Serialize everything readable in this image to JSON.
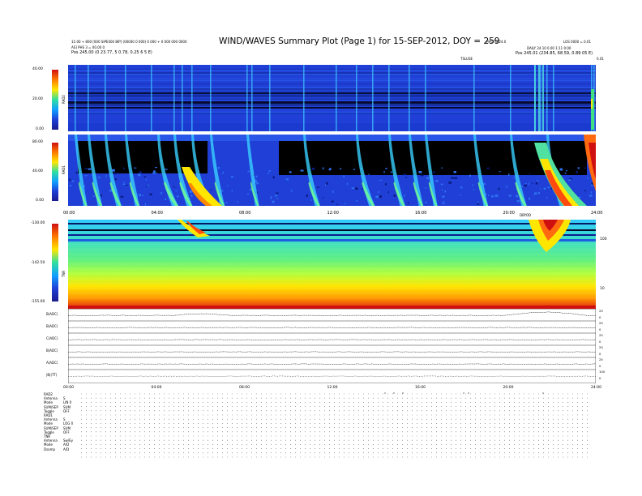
{
  "header": {
    "left_line1": "11:00 + 800 [000 SIPE000 BIP] (00000 0 000) 0 000 + 0 000 000 0000",
    "left_line2": "AS] PHS 3 = 00.00 0",
    "left_line3": "Pos 245.00 (0 23.77, 5 0.78, 0.25 6 5 E)",
    "center_right_label": "PHOTO 24.0",
    "right_line1": "LOS 0000 = 0.01",
    "right_line2": "DAILY 24.10 0.00 1:11 0:00",
    "right_line3": "Pos 245.01 (234.85, 68.59, 0.89 05 E)",
    "small_top_center": "TSLUSE",
    "small_top_right": "0.01"
  },
  "title": "WIND/WAVES Summary Plot (Page 1) for 15-SEP-2012, DOY = 259",
  "colors": {
    "spectrogram_background": "#1f3fd6",
    "dark_band": "#050a30",
    "black_region": "#000000",
    "hot": "#d01010"
  },
  "chart_data": [
    {
      "type": "heatmap",
      "panel": "RAD2",
      "ylabel": "RAD2",
      "yticks": [
        "40.00",
        "20.00",
        "0.00"
      ],
      "ylim": [
        0,
        40
      ],
      "x_ticks": [
        "00:00",
        "04:00",
        "08:00",
        "12:00",
        "16:00",
        "20:00",
        "24:00"
      ]
    },
    {
      "type": "heatmap",
      "panel": "RAD1",
      "ylabel": "RAD1",
      "yticks": [
        "80.00",
        "40.00",
        "0.00"
      ],
      "ylim": [
        0,
        80
      ],
      "x_ticks": [
        "00:00",
        "04:00",
        "08:00",
        "12:00",
        "16:00",
        "20:00",
        "24:00"
      ],
      "annotation": "DBYOD"
    },
    {
      "type": "heatmap",
      "panel": "TNR",
      "ylabel": "TNR",
      "yticks": [
        "-130.00",
        "-142.50",
        "-155.00"
      ],
      "right_ticks": [
        "100",
        "10"
      ],
      "ylim": [
        -155,
        -130
      ]
    },
    {
      "type": "line",
      "panel": "magnetic field",
      "series": [
        {
          "name": "B(ADC)",
          "right_ticks": [
            "25",
            "0"
          ]
        },
        {
          "name": "B(ADC)",
          "right_ticks": [
            "25",
            "0"
          ]
        },
        {
          "name": "C(ADC)",
          "right_ticks": [
            "25",
            "0"
          ]
        },
        {
          "name": "B(ADC)",
          "right_ticks": [
            "25",
            "0"
          ]
        },
        {
          "name": "A(ADC)",
          "right_ticks": [
            "25",
            "0"
          ]
        },
        {
          "name": "|B|(TT)",
          "right_ticks": [
            "100",
            "0"
          ]
        }
      ],
      "x_ticks": [
        "00:00",
        "04:00",
        "08:00",
        "12:00",
        "16:00",
        "20:00",
        "24:00"
      ]
    }
  ],
  "status": {
    "groups": [
      {
        "name": "RAD2",
        "rows": [
          {
            "label": "Antenna",
            "value": "S"
          },
          {
            "label": "Mode",
            "value": "LIN 0"
          },
          {
            "label": "SUM/SEP",
            "value": "SUM"
          },
          {
            "label": "Toggle",
            "value": "OFF"
          }
        ]
      },
      {
        "name": "RAD1",
        "rows": [
          {
            "label": "Antenna",
            "value": "S"
          },
          {
            "label": "Mode",
            "value": "LOG 0"
          },
          {
            "label": "SUM/SEP",
            "value": "SUM"
          },
          {
            "label": "Toggle",
            "value": "OFF"
          }
        ]
      },
      {
        "name": "TNR",
        "rows": [
          {
            "label": "Antenna",
            "value": "Sw/Ey"
          },
          {
            "label": "Mode",
            "value": "A/D"
          },
          {
            "label": "Dsamp",
            "value": "A/D"
          }
        ]
      }
    ]
  }
}
